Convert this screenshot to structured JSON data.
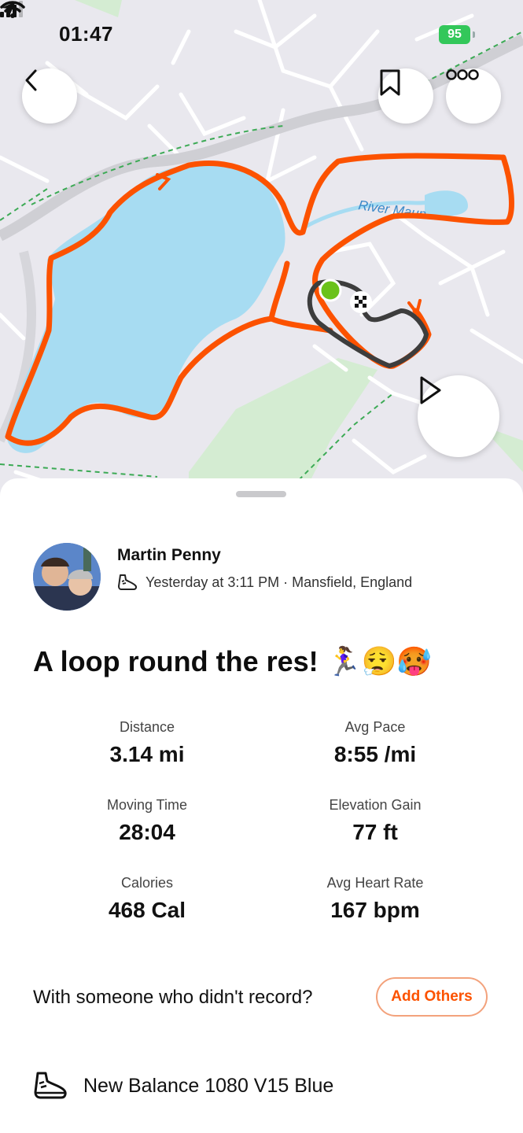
{
  "status_bar": {
    "time": "01:47",
    "battery": "95"
  },
  "map": {
    "river_label": "River Maun",
    "route_color": "#fc5200",
    "highlight_color": "#3d3d3d",
    "water_color": "#a7dcf2",
    "start_color": "#6ac21a"
  },
  "header_buttons": {
    "back": "chevron-left-icon",
    "bookmark": "bookmark-icon",
    "more": "more-icon"
  },
  "play_button": "play-icon",
  "activity": {
    "athlete_name": "Martin Penny",
    "meta": "Yesterday at 3:11 PM · Mansfield, England",
    "title": "A loop round the res! 🏃‍♀️😮‍💨🥵"
  },
  "stats": [
    {
      "label": "Distance",
      "value": "3.14 mi"
    },
    {
      "label": "Avg Pace",
      "value": "8:55 /mi"
    },
    {
      "label": "Moving Time",
      "value": "28:04"
    },
    {
      "label": "Elevation Gain",
      "value": "77 ft"
    },
    {
      "label": "Calories",
      "value": "468 Cal"
    },
    {
      "label": "Avg Heart Rate",
      "value": "167 bpm"
    }
  ],
  "with_others": {
    "prompt": "With someone who didn't record?",
    "button": "Add Others"
  },
  "gear": {
    "name": "New Balance 1080 V15 Blue"
  },
  "colors": {
    "accent": "#fc5200"
  }
}
